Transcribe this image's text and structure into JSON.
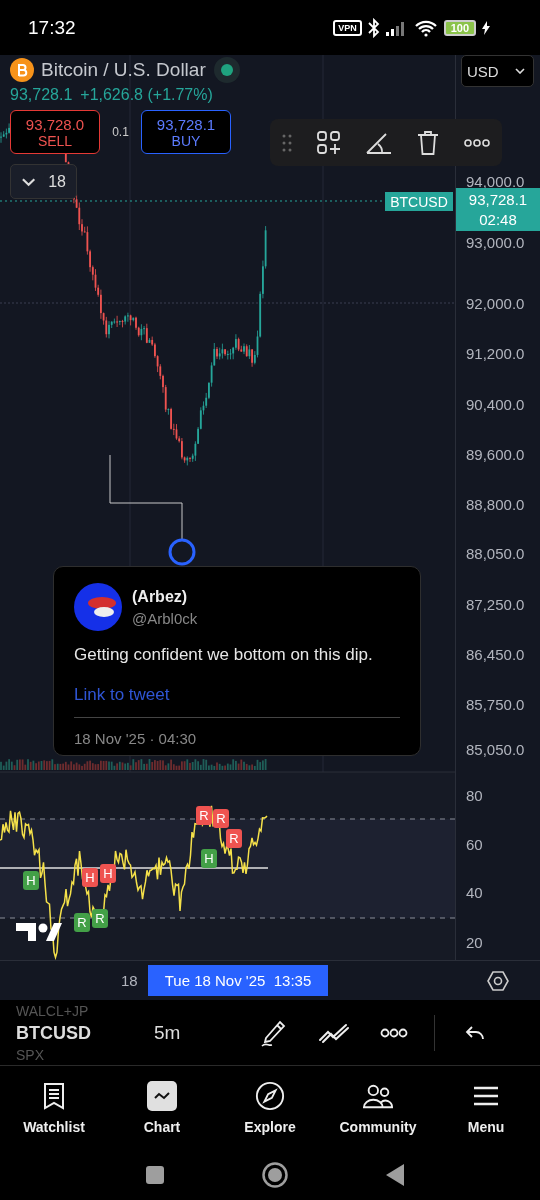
{
  "status_bar": {
    "time": "17:32",
    "vpn": "VPN",
    "battery": "100"
  },
  "header": {
    "title": "Bitcoin / U.S. Dollar",
    "market_open": true,
    "price": "93,728.1",
    "change": "+1,626.8 (+1.77%)",
    "currency": "USD"
  },
  "trade": {
    "sell_price": "93,728.0",
    "sell_label": "SELL",
    "spread": "0.1",
    "buy_price": "93,728.1",
    "buy_label": "BUY"
  },
  "indicators_toggle": {
    "count": "18",
    "expanded": false
  },
  "price_axis": {
    "labels": [
      "94,000.0",
      "93,000.0",
      "92,000.0",
      "91,200.0",
      "90,400.0",
      "89,600.0",
      "88,800.0",
      "88,050.0",
      "87,250.0",
      "86,450.0",
      "85,750.0",
      "85,050.0"
    ],
    "symbol_tag": "BTCUSD",
    "last_price": "93,728.1",
    "countdown": "02:48"
  },
  "tweet": {
    "name": "(Arbez)",
    "handle": "@Arbl0ck",
    "text": "Getting confident we bottom on this dip.",
    "link": "Link to tweet",
    "date": "18 Nov '25 · 04:30"
  },
  "rsi": {
    "axis_labels": [
      "80",
      "60",
      "40",
      "20"
    ],
    "markers": [
      {
        "label": "H",
        "color": "#43a047"
      },
      {
        "label": "R",
        "color": "#43a047"
      },
      {
        "label": "H",
        "color": "#ef5350"
      },
      {
        "label": "R",
        "color": "#43a047"
      },
      {
        "label": "H",
        "color": "#ef5350"
      },
      {
        "label": "H",
        "color": "#43a047"
      },
      {
        "label": "R",
        "color": "#ef5350"
      },
      {
        "label": "R",
        "color": "#ef5350"
      },
      {
        "label": "R",
        "color": "#ef5350"
      }
    ]
  },
  "time_axis": {
    "label": "18",
    "crosshair": "Tue 18 Nov '25  13:35"
  },
  "bottom_toolbar": {
    "symbols": [
      {
        "text": "WALCL+JP",
        "selected": false
      },
      {
        "text": "BTCUSD",
        "selected": true
      },
      {
        "text": "SPX",
        "selected": false
      }
    ],
    "interval": "5m"
  },
  "nav": [
    {
      "label": "Watchlist",
      "kind": "watchlist",
      "selected": false
    },
    {
      "label": "Chart",
      "kind": "chart",
      "selected": true
    },
    {
      "label": "Explore",
      "kind": "explore",
      "selected": false
    },
    {
      "label": "Community",
      "kind": "community",
      "selected": false
    },
    {
      "label": "Menu",
      "kind": "menu",
      "selected": false
    }
  ]
}
